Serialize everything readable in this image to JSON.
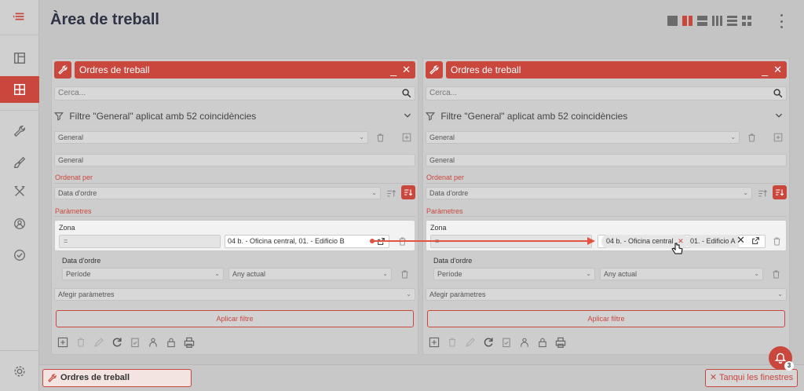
{
  "page": {
    "title": "Àrea de treball"
  },
  "colors": {
    "accent": "#c9473d",
    "sidebar_bg": "#d0d0d0",
    "workspace_bg": "#c4c4c4"
  },
  "sidebar": {
    "items": [
      {
        "icon": "menu-icon"
      },
      {
        "icon": "layout-icon"
      },
      {
        "icon": "grid-icon",
        "active": true
      },
      {
        "icon": "wrench-icon"
      },
      {
        "icon": "brush-icon"
      },
      {
        "icon": "tools-icon"
      },
      {
        "icon": "person-refresh-icon"
      },
      {
        "icon": "check-circle-icon"
      },
      {
        "icon": "gear-icon"
      }
    ]
  },
  "header": {
    "layout_icons": [
      "single-layout-icon",
      "two-column-icon",
      "two-row-icon",
      "four-column-icon",
      "list-layout-icon",
      "grid-layout-icon"
    ],
    "more_icon": "more-vertical-icon"
  },
  "left_panel": {
    "title": "Ordres de treball",
    "search_placeholder": "Cerca...",
    "filter_title": "Filtre \"General\" aplicat amb 52 coincidències",
    "filter_select": "General",
    "filter_name": "General",
    "order_label": "Ordenat per",
    "order_select": "Data d'ordre",
    "params_label": "Paràmetres",
    "zona_label": "Zona",
    "zona_operator": "=",
    "zona_value": "04 b. - Oficina central, 01. - Edificio B",
    "data_label": "Data d'ordre",
    "period_select": "Període",
    "period_value": "Any actual",
    "add_params": "Afegir paràmetres",
    "apply_button": "Aplicar filtre"
  },
  "right_panel": {
    "title": "Ordres de treball",
    "search_placeholder": "Cerca...",
    "filter_title": "Filtre \"General\" aplicat amb 52 coincidències",
    "filter_select": "General",
    "filter_name": "General",
    "order_label": "Ordenat per",
    "order_select": "Data d'ordre",
    "params_label": "Paràmetres",
    "zona_label": "Zona",
    "zona_operator": "=",
    "zona_chip_1": "04 b. - Oficina central",
    "zona_chip_2": "01. - Edificio A",
    "data_label": "Data d'ordre",
    "period_select": "Període",
    "period_value": "Any actual",
    "add_params": "Afegir paràmetres",
    "apply_button": "Aplicar filtre"
  },
  "taskbar": {
    "open_window": "Ordres de treball",
    "close_all": "Tanqui les finestres"
  },
  "notifications": {
    "count": "3"
  }
}
